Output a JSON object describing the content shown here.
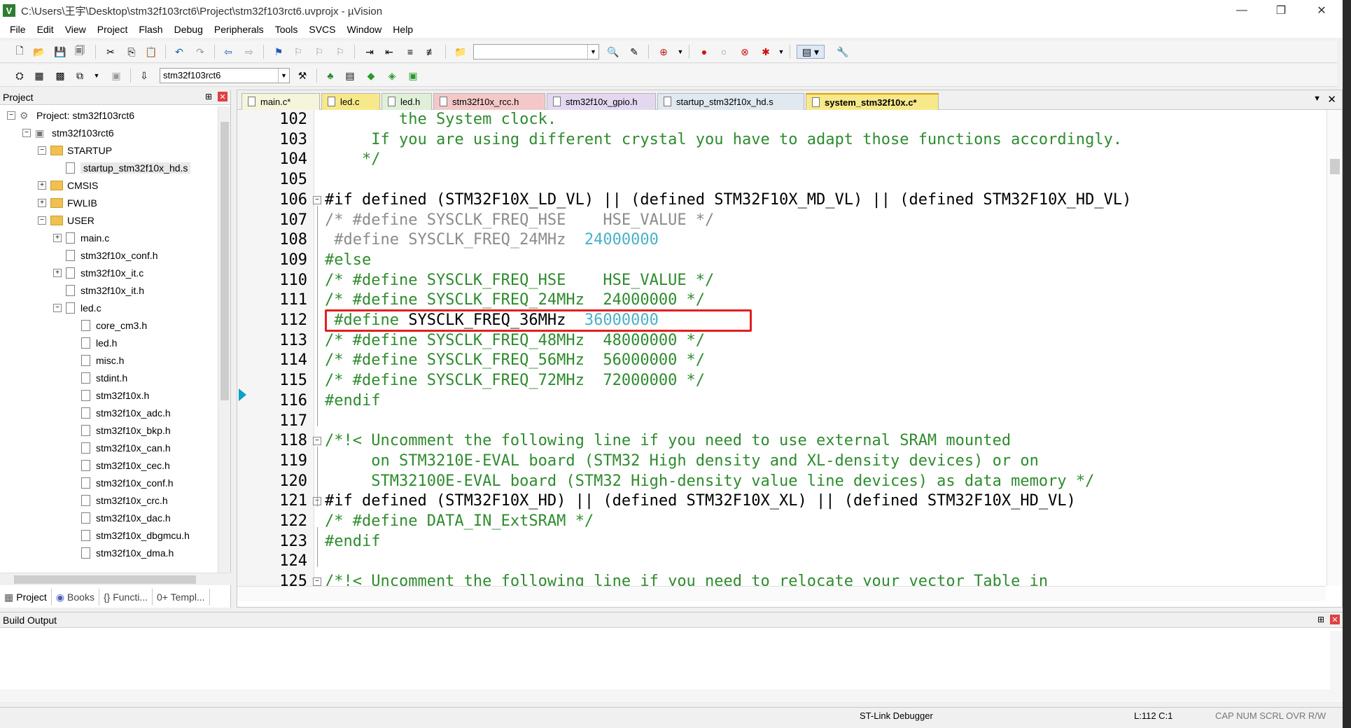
{
  "window": {
    "title": "C:\\Users\\王宇\\Desktop\\stm32f103rct6\\Project\\stm32f103rct6.uvprojx - µVision",
    "app_icon": "V",
    "minimize": "—",
    "maximize": "❐",
    "close": "✕"
  },
  "menu": [
    "File",
    "Edit",
    "View",
    "Project",
    "Flash",
    "Debug",
    "Peripherals",
    "Tools",
    "SVCS",
    "Window",
    "Help"
  ],
  "toolbar2": {
    "target": "stm32f103rct6"
  },
  "project_panel": {
    "title": "Project",
    "pin": "⊞",
    "close": "✕",
    "tree": [
      {
        "label": "Project: stm32f103rct6",
        "indent": 0,
        "type": "project",
        "exp": "−"
      },
      {
        "label": "stm32f103rct6",
        "indent": 1,
        "type": "target",
        "exp": "−"
      },
      {
        "label": "STARTUP",
        "indent": 2,
        "type": "folder",
        "exp": "−"
      },
      {
        "label": "startup_stm32f10x_hd.s",
        "indent": 3,
        "type": "file",
        "exp": "",
        "selected": true
      },
      {
        "label": "CMSIS",
        "indent": 2,
        "type": "folder",
        "exp": "+"
      },
      {
        "label": "FWLIB",
        "indent": 2,
        "type": "folder",
        "exp": "+"
      },
      {
        "label": "USER",
        "indent": 2,
        "type": "folder",
        "exp": "−"
      },
      {
        "label": "main.c",
        "indent": 3,
        "type": "file",
        "exp": "+"
      },
      {
        "label": "stm32f10x_conf.h",
        "indent": 3,
        "type": "file",
        "exp": ""
      },
      {
        "label": "stm32f10x_it.c",
        "indent": 3,
        "type": "file",
        "exp": "+"
      },
      {
        "label": "stm32f10x_it.h",
        "indent": 3,
        "type": "file",
        "exp": ""
      },
      {
        "label": "led.c",
        "indent": 3,
        "type": "file",
        "exp": "−"
      },
      {
        "label": "core_cm3.h",
        "indent": 4,
        "type": "file",
        "exp": ""
      },
      {
        "label": "led.h",
        "indent": 4,
        "type": "file",
        "exp": ""
      },
      {
        "label": "misc.h",
        "indent": 4,
        "type": "file",
        "exp": ""
      },
      {
        "label": "stdint.h",
        "indent": 4,
        "type": "file",
        "exp": ""
      },
      {
        "label": "stm32f10x.h",
        "indent": 4,
        "type": "file",
        "exp": ""
      },
      {
        "label": "stm32f10x_adc.h",
        "indent": 4,
        "type": "file",
        "exp": ""
      },
      {
        "label": "stm32f10x_bkp.h",
        "indent": 4,
        "type": "file",
        "exp": ""
      },
      {
        "label": "stm32f10x_can.h",
        "indent": 4,
        "type": "file",
        "exp": ""
      },
      {
        "label": "stm32f10x_cec.h",
        "indent": 4,
        "type": "file",
        "exp": ""
      },
      {
        "label": "stm32f10x_conf.h",
        "indent": 4,
        "type": "file",
        "exp": ""
      },
      {
        "label": "stm32f10x_crc.h",
        "indent": 4,
        "type": "file",
        "exp": ""
      },
      {
        "label": "stm32f10x_dac.h",
        "indent": 4,
        "type": "file",
        "exp": ""
      },
      {
        "label": "stm32f10x_dbgmcu.h",
        "indent": 4,
        "type": "file",
        "exp": ""
      },
      {
        "label": "stm32f10x_dma.h",
        "indent": 4,
        "type": "file",
        "exp": ""
      }
    ],
    "bottom_tabs": [
      "Project",
      "Books",
      "{} Functi...",
      "0+ Templ..."
    ]
  },
  "editor": {
    "tabs": [
      {
        "label": "main.c*",
        "color": "#f5f5dc"
      },
      {
        "label": "led.c",
        "color": "#f7e88a"
      },
      {
        "label": "led.h",
        "color": "#e0f0d8"
      },
      {
        "label": "stm32f10x_rcc.h",
        "color": "#f4c8c8"
      },
      {
        "label": "stm32f10x_gpio.h",
        "color": "#e4d8f0"
      },
      {
        "label": "startup_stm32f10x_hd.s",
        "color": "#e0e8f0"
      },
      {
        "label": "system_stm32f10x.c*",
        "color": "#f7e88a",
        "active": true
      }
    ],
    "tab_dropdown": "▼",
    "tab_close": "✕",
    "lines": [
      {
        "n": "102",
        "fold": "",
        "segs": [
          {
            "t": "        the System clock.",
            "c": "c-cmt"
          }
        ]
      },
      {
        "n": "103",
        "fold": "",
        "segs": [
          {
            "t": "     If you are using different crystal you have to adapt those functions accordingly.",
            "c": "c-cmt"
          }
        ]
      },
      {
        "n": "104",
        "fold": "",
        "segs": [
          {
            "t": "    */",
            "c": "c-cmt"
          }
        ]
      },
      {
        "n": "105",
        "fold": "",
        "segs": []
      },
      {
        "n": "106",
        "fold": "−",
        "segs": [
          {
            "t": "#if defined (STM32F10X_LD_VL) || (defined STM32F10X_MD_VL) || (defined STM32F10X_HD_VL)",
            "c": "c-def"
          }
        ]
      },
      {
        "n": "107",
        "fold": "",
        "segs": [
          {
            "t": "/* #define SYSCLK_FREQ_HSE    HSE_VALUE */",
            "c": "c-pp"
          }
        ]
      },
      {
        "n": "108",
        "fold": "",
        "segs": [
          {
            "t": " #define ",
            "c": "c-pp"
          },
          {
            "t": "SYSCLK_FREQ_24MHz  ",
            "c": "c-pp"
          },
          {
            "t": "24000000",
            "c": "c-num"
          }
        ]
      },
      {
        "n": "109",
        "fold": "",
        "segs": [
          {
            "t": "#else",
            "c": "c-cmt"
          }
        ]
      },
      {
        "n": "110",
        "fold": "",
        "segs": [
          {
            "t": "/* #define SYSCLK_FREQ_HSE    HSE_VALUE */",
            "c": "c-cmt"
          }
        ]
      },
      {
        "n": "111",
        "fold": "",
        "segs": [
          {
            "t": "/* #define SYSCLK_FREQ_24MHz  24000000 */",
            "c": "c-cmt"
          }
        ]
      },
      {
        "n": "112",
        "fold": "",
        "segs": [
          {
            "t": " #define ",
            "c": "c-cmt"
          },
          {
            "t": "SYSCLK_FREQ_36MHz  ",
            "c": "c-def"
          },
          {
            "t": "36000000",
            "c": "c-num"
          }
        ]
      },
      {
        "n": "113",
        "fold": "",
        "segs": [
          {
            "t": "/* #define SYSCLK_FREQ_48MHz  48000000 */",
            "c": "c-cmt"
          }
        ]
      },
      {
        "n": "114",
        "fold": "",
        "segs": [
          {
            "t": "/* #define SYSCLK_FREQ_56MHz  56000000 */",
            "c": "c-cmt"
          }
        ]
      },
      {
        "n": "115",
        "fold": "",
        "segs": [
          {
            "t": "/* #define SYSCLK_FREQ_72MHz  72000000 */",
            "c": "c-cmt"
          }
        ]
      },
      {
        "n": "116",
        "fold": "",
        "segs": [
          {
            "t": "#endif",
            "c": "c-cmt"
          }
        ]
      },
      {
        "n": "117",
        "fold": "",
        "segs": []
      },
      {
        "n": "118",
        "fold": "−",
        "segs": [
          {
            "t": "/*!< Uncomment the following line if you need to use external SRAM mounted",
            "c": "c-cmt"
          }
        ]
      },
      {
        "n": "119",
        "fold": "",
        "segs": [
          {
            "t": "     on STM3210E-EVAL board (STM32 High density and XL-density devices) or on",
            "c": "c-cmt"
          }
        ]
      },
      {
        "n": "120",
        "fold": "",
        "segs": [
          {
            "t": "     STM32100E-EVAL board (STM32 High-density value line devices) as data memory */",
            "c": "c-cmt"
          }
        ]
      },
      {
        "n": "121",
        "fold": "−",
        "segs": [
          {
            "t": "#if defined (STM32F10X_HD) || (defined STM32F10X_XL) || (defined STM32F10X_HD_VL)",
            "c": "c-def"
          }
        ]
      },
      {
        "n": "122",
        "fold": "",
        "segs": [
          {
            "t": "/* #define DATA_IN_ExtSRAM */",
            "c": "c-cmt"
          }
        ]
      },
      {
        "n": "123",
        "fold": "",
        "segs": [
          {
            "t": "#endif",
            "c": "c-cmt"
          }
        ]
      },
      {
        "n": "124",
        "fold": "",
        "segs": []
      },
      {
        "n": "125",
        "fold": "−",
        "segs": [
          {
            "t": "/*!< Uncomment the following line if you need to relocate your vector Table in",
            "c": "c-cmt"
          }
        ]
      }
    ]
  },
  "build_output": {
    "title": "Build Output"
  },
  "status": {
    "debugger": "ST-Link Debugger",
    "position": "L:112 C:1",
    "indicators": "CAP  NUM  SCRL  OVR  R/W"
  }
}
